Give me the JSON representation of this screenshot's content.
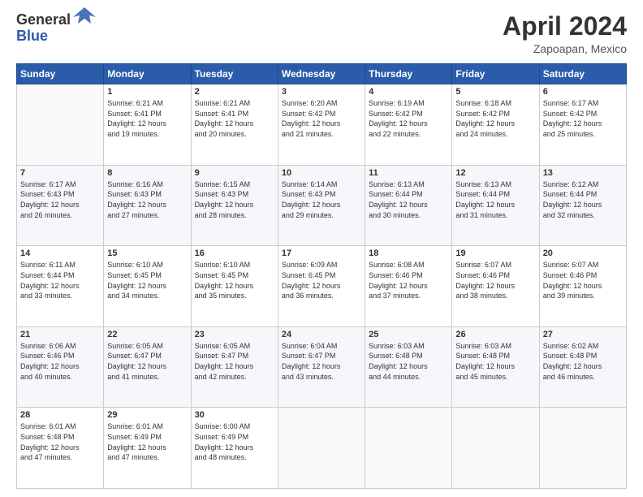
{
  "header": {
    "logo_text_general": "General",
    "logo_text_blue": "Blue",
    "month": "April 2024",
    "location": "Zapoapan, Mexico"
  },
  "days_of_week": [
    "Sunday",
    "Monday",
    "Tuesday",
    "Wednesday",
    "Thursday",
    "Friday",
    "Saturday"
  ],
  "weeks": [
    [
      {
        "day": "",
        "info": ""
      },
      {
        "day": "1",
        "info": "Sunrise: 6:21 AM\nSunset: 6:41 PM\nDaylight: 12 hours\nand 19 minutes."
      },
      {
        "day": "2",
        "info": "Sunrise: 6:21 AM\nSunset: 6:41 PM\nDaylight: 12 hours\nand 20 minutes."
      },
      {
        "day": "3",
        "info": "Sunrise: 6:20 AM\nSunset: 6:42 PM\nDaylight: 12 hours\nand 21 minutes."
      },
      {
        "day": "4",
        "info": "Sunrise: 6:19 AM\nSunset: 6:42 PM\nDaylight: 12 hours\nand 22 minutes."
      },
      {
        "day": "5",
        "info": "Sunrise: 6:18 AM\nSunset: 6:42 PM\nDaylight: 12 hours\nand 24 minutes."
      },
      {
        "day": "6",
        "info": "Sunrise: 6:17 AM\nSunset: 6:42 PM\nDaylight: 12 hours\nand 25 minutes."
      }
    ],
    [
      {
        "day": "7",
        "info": "Sunrise: 6:17 AM\nSunset: 6:43 PM\nDaylight: 12 hours\nand 26 minutes."
      },
      {
        "day": "8",
        "info": "Sunrise: 6:16 AM\nSunset: 6:43 PM\nDaylight: 12 hours\nand 27 minutes."
      },
      {
        "day": "9",
        "info": "Sunrise: 6:15 AM\nSunset: 6:43 PM\nDaylight: 12 hours\nand 28 minutes."
      },
      {
        "day": "10",
        "info": "Sunrise: 6:14 AM\nSunset: 6:43 PM\nDaylight: 12 hours\nand 29 minutes."
      },
      {
        "day": "11",
        "info": "Sunrise: 6:13 AM\nSunset: 6:44 PM\nDaylight: 12 hours\nand 30 minutes."
      },
      {
        "day": "12",
        "info": "Sunrise: 6:13 AM\nSunset: 6:44 PM\nDaylight: 12 hours\nand 31 minutes."
      },
      {
        "day": "13",
        "info": "Sunrise: 6:12 AM\nSunset: 6:44 PM\nDaylight: 12 hours\nand 32 minutes."
      }
    ],
    [
      {
        "day": "14",
        "info": "Sunrise: 6:11 AM\nSunset: 6:44 PM\nDaylight: 12 hours\nand 33 minutes."
      },
      {
        "day": "15",
        "info": "Sunrise: 6:10 AM\nSunset: 6:45 PM\nDaylight: 12 hours\nand 34 minutes."
      },
      {
        "day": "16",
        "info": "Sunrise: 6:10 AM\nSunset: 6:45 PM\nDaylight: 12 hours\nand 35 minutes."
      },
      {
        "day": "17",
        "info": "Sunrise: 6:09 AM\nSunset: 6:45 PM\nDaylight: 12 hours\nand 36 minutes."
      },
      {
        "day": "18",
        "info": "Sunrise: 6:08 AM\nSunset: 6:46 PM\nDaylight: 12 hours\nand 37 minutes."
      },
      {
        "day": "19",
        "info": "Sunrise: 6:07 AM\nSunset: 6:46 PM\nDaylight: 12 hours\nand 38 minutes."
      },
      {
        "day": "20",
        "info": "Sunrise: 6:07 AM\nSunset: 6:46 PM\nDaylight: 12 hours\nand 39 minutes."
      }
    ],
    [
      {
        "day": "21",
        "info": "Sunrise: 6:06 AM\nSunset: 6:46 PM\nDaylight: 12 hours\nand 40 minutes."
      },
      {
        "day": "22",
        "info": "Sunrise: 6:05 AM\nSunset: 6:47 PM\nDaylight: 12 hours\nand 41 minutes."
      },
      {
        "day": "23",
        "info": "Sunrise: 6:05 AM\nSunset: 6:47 PM\nDaylight: 12 hours\nand 42 minutes."
      },
      {
        "day": "24",
        "info": "Sunrise: 6:04 AM\nSunset: 6:47 PM\nDaylight: 12 hours\nand 43 minutes."
      },
      {
        "day": "25",
        "info": "Sunrise: 6:03 AM\nSunset: 6:48 PM\nDaylight: 12 hours\nand 44 minutes."
      },
      {
        "day": "26",
        "info": "Sunrise: 6:03 AM\nSunset: 6:48 PM\nDaylight: 12 hours\nand 45 minutes."
      },
      {
        "day": "27",
        "info": "Sunrise: 6:02 AM\nSunset: 6:48 PM\nDaylight: 12 hours\nand 46 minutes."
      }
    ],
    [
      {
        "day": "28",
        "info": "Sunrise: 6:01 AM\nSunset: 6:48 PM\nDaylight: 12 hours\nand 47 minutes."
      },
      {
        "day": "29",
        "info": "Sunrise: 6:01 AM\nSunset: 6:49 PM\nDaylight: 12 hours\nand 47 minutes."
      },
      {
        "day": "30",
        "info": "Sunrise: 6:00 AM\nSunset: 6:49 PM\nDaylight: 12 hours\nand 48 minutes."
      },
      {
        "day": "",
        "info": ""
      },
      {
        "day": "",
        "info": ""
      },
      {
        "day": "",
        "info": ""
      },
      {
        "day": "",
        "info": ""
      }
    ]
  ]
}
